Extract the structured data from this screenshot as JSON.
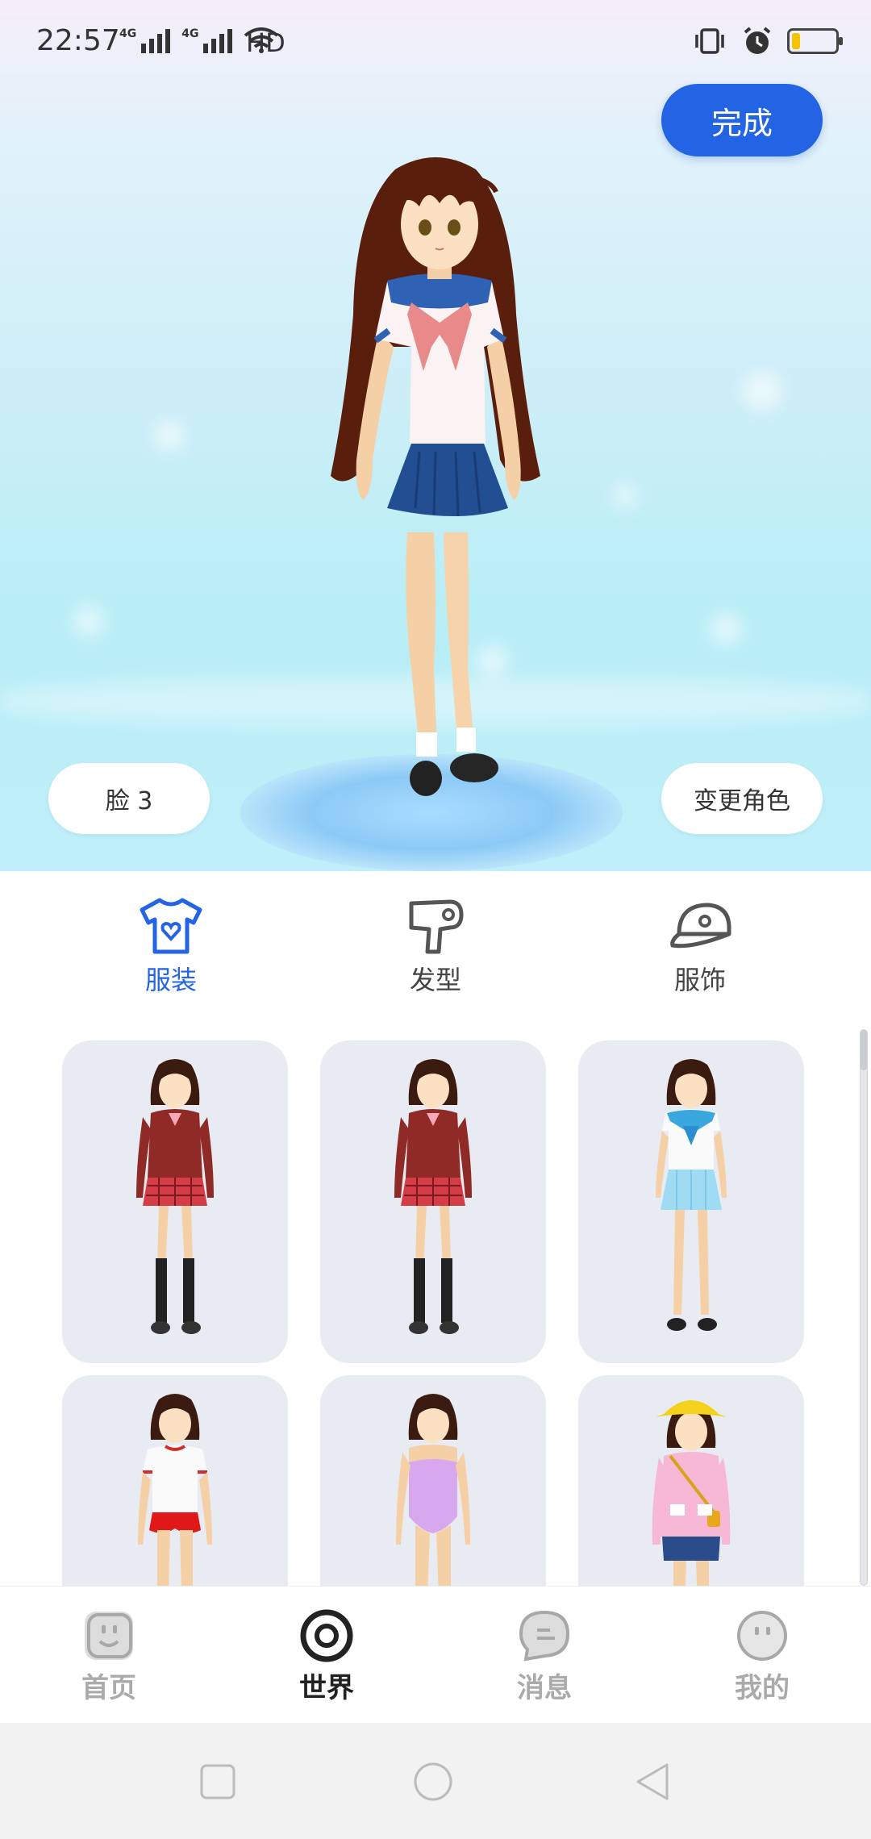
{
  "status_bar": {
    "time": "22:57",
    "network_1": "4G",
    "network_2": "4G",
    "hd": "HD",
    "icons": [
      "vibrate-icon",
      "alarm-icon",
      "battery-icon"
    ],
    "battery_color": "#f5c400"
  },
  "header": {
    "done_label": "完成"
  },
  "stage": {
    "face_label": "脸 3",
    "change_role_label": "变更角色"
  },
  "tabs": [
    {
      "label": "服装",
      "icon": "shirt-icon",
      "active": true
    },
    {
      "label": "发型",
      "icon": "hair-dryer-icon",
      "active": false
    },
    {
      "label": "服饰",
      "icon": "cap-icon",
      "active": false
    }
  ],
  "outfits": [
    {
      "name": "red-blazer-plaid-skirt-black-socks"
    },
    {
      "name": "red-blazer-plaid-skirt-black-socks-2"
    },
    {
      "name": "sailor-uniform-light-blue"
    },
    {
      "name": "gym-uniform-red-shorts"
    },
    {
      "name": "purple-swimsuit"
    },
    {
      "name": "pink-coat-yellow-hat"
    }
  ],
  "bottom_nav": [
    {
      "label": "首页",
      "icon": "home-face-icon",
      "active": false
    },
    {
      "label": "世界",
      "icon": "world-ring-icon",
      "active": true
    },
    {
      "label": "消息",
      "icon": "message-bubble-icon",
      "active": false
    },
    {
      "label": "我的",
      "icon": "profile-face-icon",
      "active": false
    }
  ],
  "colors": {
    "accent": "#2264e4",
    "inactive": "#aaaaaa",
    "card_bg": "#e8ecf2"
  }
}
